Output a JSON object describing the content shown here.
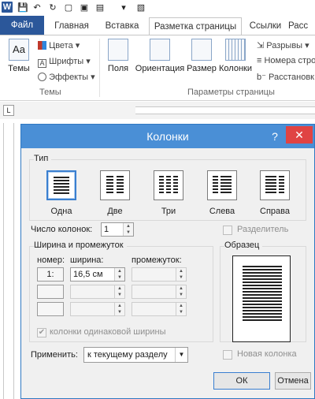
{
  "qat": {
    "logo": "W"
  },
  "tabs": [
    "Файл",
    "Главная",
    "Вставка",
    "Разметка страницы",
    "Ссылки",
    "Расс"
  ],
  "ribbon": {
    "themes": {
      "big_label": "Темы",
      "colors": "Цвета",
      "fonts": "Шрифты",
      "effects": "Эффекты",
      "group": "Темы"
    },
    "page_setup": {
      "margins": "Поля",
      "orientation": "Ориентация",
      "size": "Размер",
      "columns": "Колонки",
      "breaks": "Разрывы",
      "line_numbers": "Номера строк",
      "hyphenation": "Расстановк",
      "group": "Параметры страницы"
    }
  },
  "dialog": {
    "title": "Колонки",
    "help": "?",
    "close": "✕",
    "type_label": "Тип",
    "presets": [
      "Одна",
      "Две",
      "Три",
      "Слева",
      "Справа"
    ],
    "num_columns_label": "Число колонок:",
    "num_columns_value": "1",
    "separator_label": "Разделитель",
    "width_spacing_label": "Ширина и промежуток",
    "col_num_label": "номер:",
    "width_label": "ширина:",
    "spacing_label": "промежуток:",
    "row1_num": "1:",
    "row1_width": "16,5 см",
    "equal_width_label": "колонки одинаковой ширины",
    "sample_label": "Образец",
    "apply_label": "Применить:",
    "apply_value": "к текущему разделу",
    "new_column_label": "Новая колонка",
    "ok": "ОК",
    "cancel": "Отмена"
  }
}
